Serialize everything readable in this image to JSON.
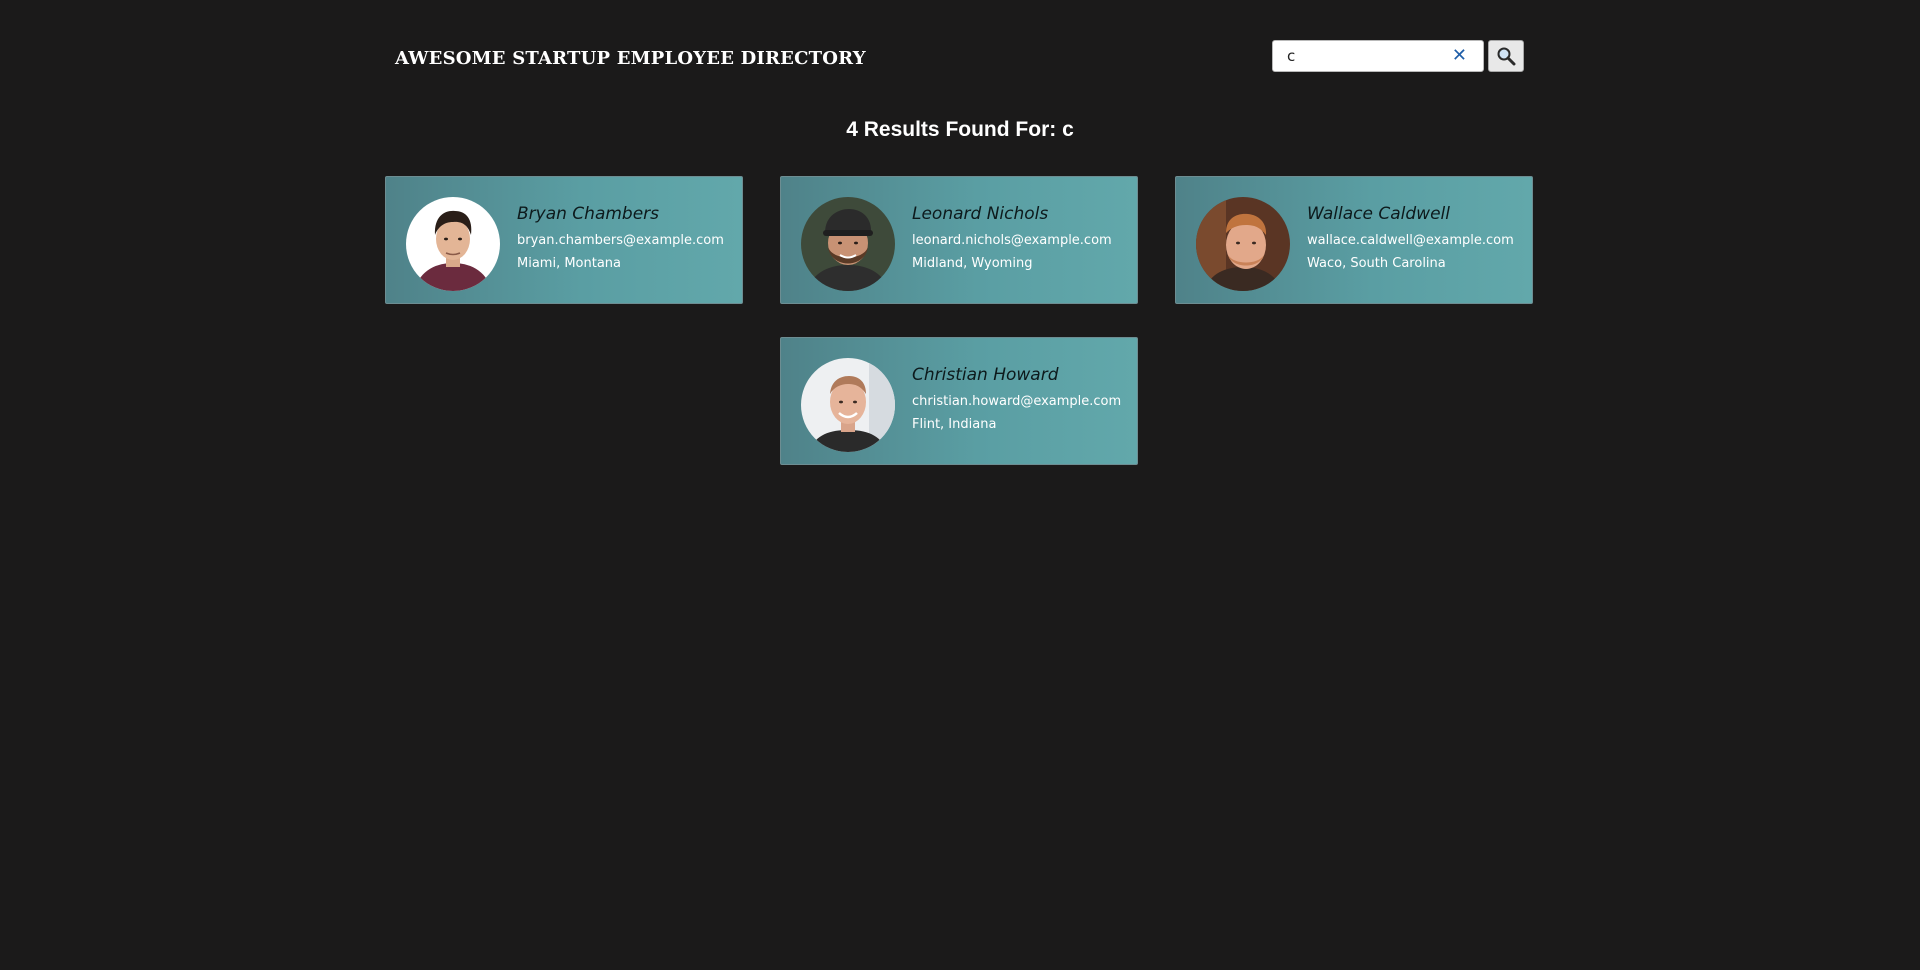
{
  "header": {
    "title": "AWESOME STARTUP EMPLOYEE DIRECTORY"
  },
  "search": {
    "value": "c",
    "clear_icon": "close-icon",
    "button_icon": "search-icon"
  },
  "results": {
    "heading": "4 Results Found For: c"
  },
  "colors": {
    "background": "#1b1a1a",
    "card_gradient_start": "#4f8289",
    "card_gradient_end": "#62a8ab",
    "clear_icon": "#1f5ea8"
  },
  "employees": [
    {
      "name": "Bryan Chambers",
      "email": "bryan.chambers@example.com",
      "location": "Miami, Montana"
    },
    {
      "name": "Leonard Nichols",
      "email": "leonard.nichols@example.com",
      "location": "Midland, Wyoming"
    },
    {
      "name": "Wallace Caldwell",
      "email": "wallace.caldwell@example.com",
      "location": "Waco, South Carolina"
    },
    {
      "name": "Christian Howard",
      "email": "christian.howard@example.com",
      "location": "Flint, Indiana"
    }
  ]
}
